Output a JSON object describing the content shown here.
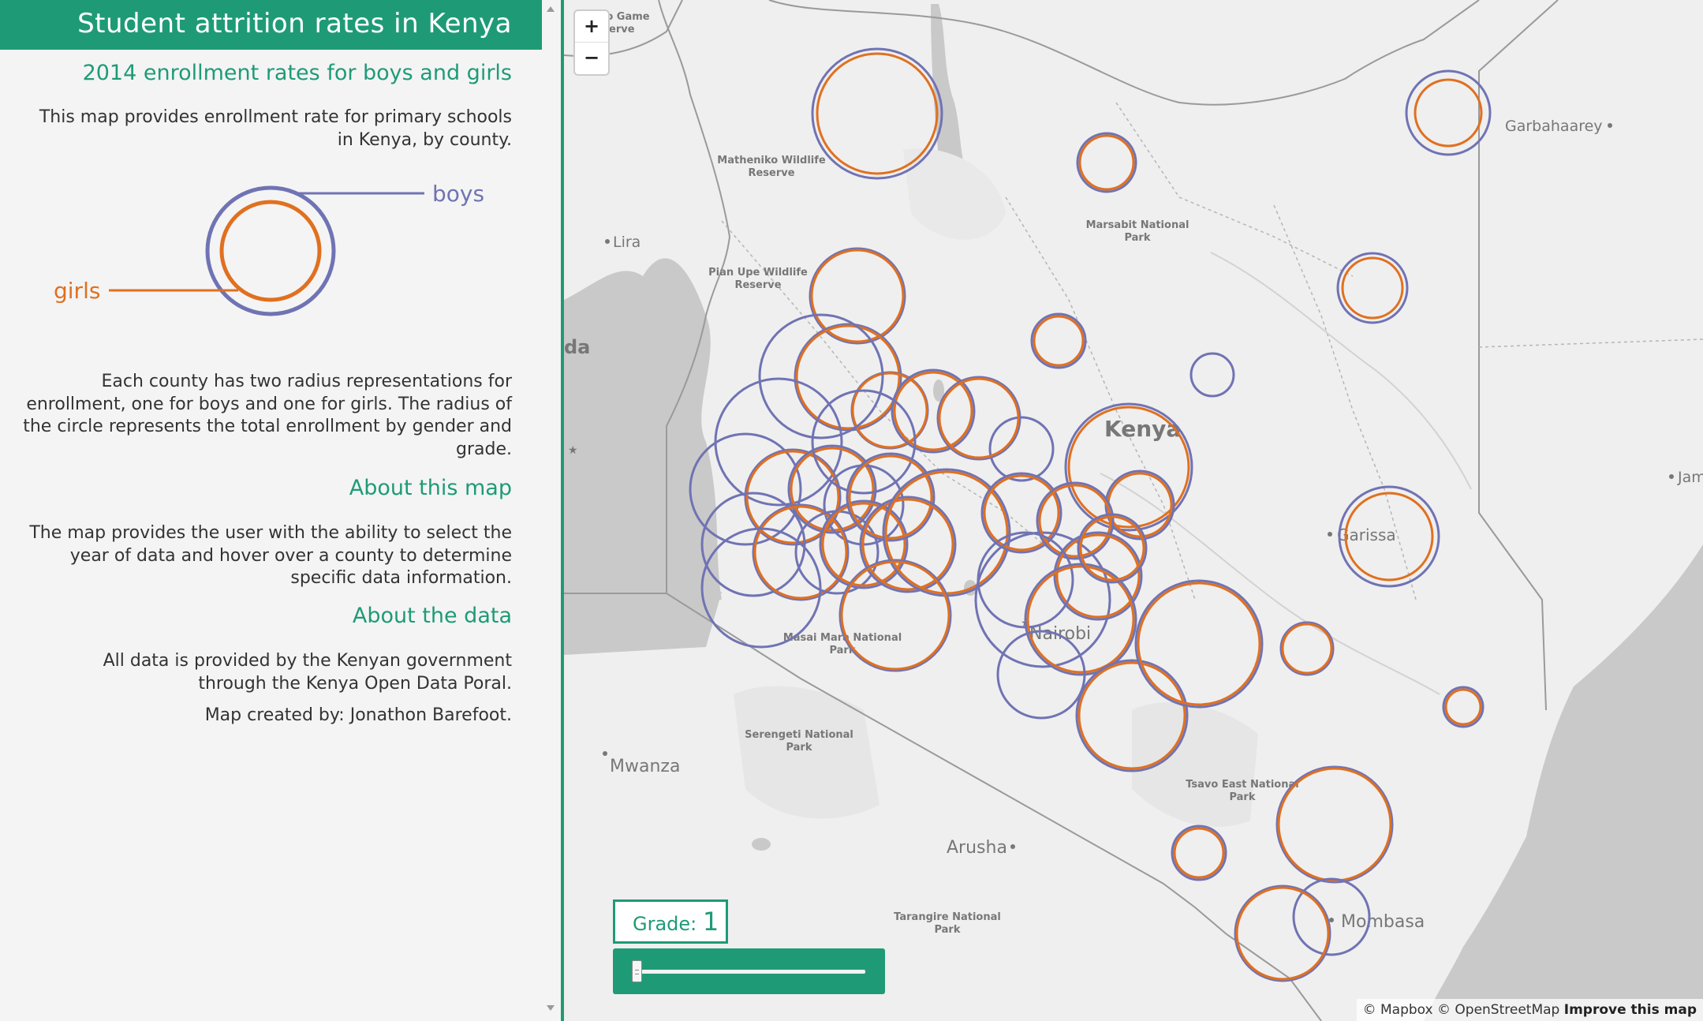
{
  "sidebar": {
    "title": "Student attrition rates in Kenya",
    "subtitle": "2014 enrollment rates for boys and girls",
    "intro": "This map provides enrollment rate for primary schools in Kenya, by county.",
    "legend": {
      "boys_label": "boys",
      "girls_label": "girls"
    },
    "description": "Each county has two radius representations for enrollment, one for boys and one for girls. The radius of the circle represents the total enrollment by gender and grade.",
    "about_map_heading": "About this map",
    "about_map_text": "The map provides the user with the ability to select the year of data and hover over a county to determine specific data information.",
    "about_data_heading": "About the data",
    "about_data_text": "All data is provided by the Kenyan government through the Kenya Open Data Poral.",
    "credit": "Map created by: Jonathon Barefoot."
  },
  "colors": {
    "accent": "#1e9b76",
    "boys": "#7073b3",
    "girls": "#e07020",
    "map_land": "#efefef",
    "map_water": "#c9c9c9"
  },
  "map": {
    "zoom_in_label": "+",
    "zoom_out_label": "−",
    "labels": {
      "country": "Kenya",
      "nairobi": "Nairobi",
      "garissa": "Garissa",
      "mombasa": "Mombasa",
      "mwanza": "Mwanza",
      "arusha": "Arusha",
      "lira": "Lira",
      "garbahaarey": "Garbahaarey",
      "jam": "Jam",
      "da": "da"
    },
    "parks": {
      "kidepo": [
        "Kidepo Game",
        "Reserve"
      ],
      "matheniko": [
        "Matheniko Wildlife",
        "Reserve"
      ],
      "pian_upe": [
        "Pian Upe Wildlife",
        "Reserve"
      ],
      "marsabit": [
        "Marsabit National",
        "Park"
      ],
      "masai_mara": [
        "Masai Mara National",
        "Park"
      ],
      "serengeti": [
        "Serengeti National",
        "Park"
      ],
      "tsavo_east": [
        "Tsavo East National",
        "Park"
      ],
      "tarangire": [
        "Tarangire National",
        "Park"
      ]
    },
    "grade_label": "Grade:",
    "grade_value": "1",
    "slider_value": 1,
    "attribution": "© Mapbox © OpenStreetMap",
    "improve_link": "Improve this map"
  }
}
